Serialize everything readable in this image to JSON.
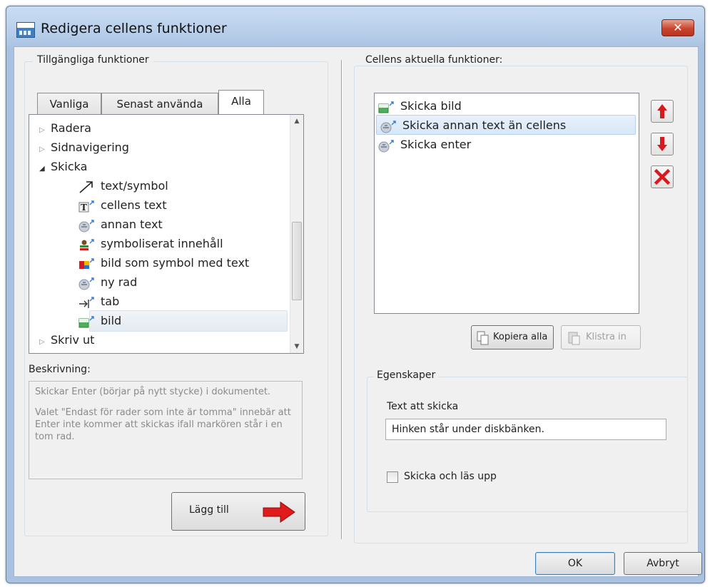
{
  "window": {
    "title": "Redigera cellens funktioner",
    "close_symbol": "✕"
  },
  "left": {
    "group_title": "Tillgängliga funktioner",
    "tabs": [
      {
        "label": "Vanliga",
        "active": false
      },
      {
        "label": "Senast använda",
        "active": false
      },
      {
        "label": "Alla",
        "active": true
      }
    ],
    "tree": [
      {
        "label": "Radera",
        "expander": "▷",
        "icon": ""
      },
      {
        "label": "Sidnavigering",
        "expander": "▷",
        "icon": ""
      },
      {
        "label": "Skicka",
        "expander": "◢",
        "icon": ""
      },
      {
        "label": "text/symbol",
        "icon": "arrow-icon"
      },
      {
        "label": "cellens text",
        "icon": "text-icon"
      },
      {
        "label": "annan text",
        "icon": "speech-icon"
      },
      {
        "label": "symboliserat innehåll",
        "icon": "symbol-icon"
      },
      {
        "label": "bild som symbol med text",
        "icon": "picture-symbol-icon"
      },
      {
        "label": "ny rad",
        "icon": "speech-icon",
        "selected": true
      },
      {
        "label": "tab",
        "icon": "tab-icon"
      },
      {
        "label": "bild",
        "icon": "image-icon"
      },
      {
        "label": "Skriv ut",
        "expander": "▷",
        "icon": ""
      }
    ],
    "description_label": "Beskrivning:",
    "description_lines": [
      "Skickar Enter (börjar på nytt stycke) i dokumentet.",
      "Valet \"Endast för rader som inte är tomma\" innebär att Enter inte kommer att skickas ifall markören står i en tom rad."
    ],
    "add_button": "Lägg till"
  },
  "right": {
    "group_title": "Cellens aktuella funktioner:",
    "items": [
      {
        "label": "Skicka bild",
        "icon": "image-icon"
      },
      {
        "label": "Skicka annan text än cellens",
        "icon": "speech-icon",
        "selected": true
      },
      {
        "label": "Skicka enter",
        "icon": "speech-icon"
      }
    ],
    "copy_all": "Kopiera alla",
    "paste": "Klistra in",
    "properties_title": "Egenskaper",
    "text_to_send_label": "Text att skicka",
    "text_to_send_value": "Hinken står under diskbänken.",
    "checkbox_label": "Skicka och läs upp",
    "checkbox_checked": false
  },
  "footer": {
    "ok": "OK",
    "cancel": "Avbryt"
  },
  "colors": {
    "accent_red": "#d8191f",
    "selection": "#d7e7f9"
  }
}
